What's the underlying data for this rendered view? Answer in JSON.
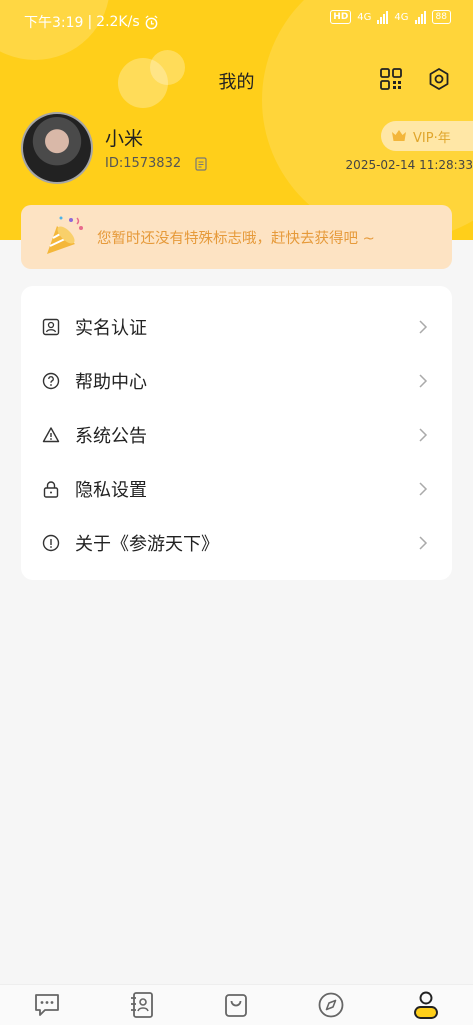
{
  "status_bar": {
    "time": "下午3:19",
    "speed": "2.2K/s",
    "network1": "4G",
    "network2": "4G",
    "hd": "HD",
    "battery": "88"
  },
  "header": {
    "title": "我的"
  },
  "profile": {
    "name": "小米",
    "id": "ID:1573832",
    "vip_label": "VIP·年",
    "expiry": "2025-02-14 11:28:33"
  },
  "banner": {
    "text": "您暂时还没有特殊标志哦，赶快去获得吧 ~"
  },
  "menu": {
    "items": [
      {
        "label": "实名认证",
        "icon": "id-card-icon"
      },
      {
        "label": "帮助中心",
        "icon": "help-icon"
      },
      {
        "label": "系统公告",
        "icon": "warning-icon"
      },
      {
        "label": "隐私设置",
        "icon": "lock-icon"
      },
      {
        "label": "关于《参游天下》",
        "icon": "info-icon"
      }
    ]
  },
  "tabbar": {
    "tabs": [
      {
        "icon": "message-icon"
      },
      {
        "icon": "contacts-icon"
      },
      {
        "icon": "bag-icon"
      },
      {
        "icon": "compass-icon"
      },
      {
        "icon": "profile-icon",
        "active": true
      }
    ]
  },
  "colors": {
    "brand": "#ffcf1a",
    "banner_bg": "#fde3c3",
    "banner_text": "#e69a3a",
    "vip_text": "#e0a52b"
  }
}
